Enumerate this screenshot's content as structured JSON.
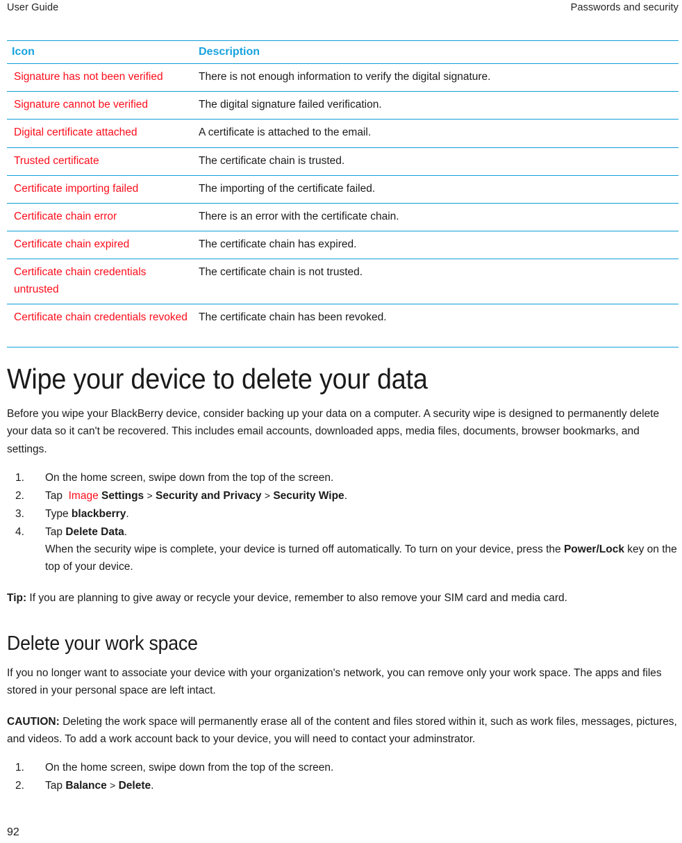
{
  "header": {
    "left": "User Guide",
    "right": "Passwords and security"
  },
  "icon_table": {
    "columns": [
      "Icon",
      "Description"
    ],
    "rows": [
      {
        "icon": "Signature has not been verified",
        "description": "There is not enough information to verify the digital signature."
      },
      {
        "icon": "Signature cannot be verified",
        "description": "The digital signature failed verification."
      },
      {
        "icon": "Digital certificate attached",
        "description": "A certificate is attached to the email."
      },
      {
        "icon": "Trusted certificate",
        "description": "The certificate chain is trusted."
      },
      {
        "icon": "Certificate importing failed",
        "description": "The importing of the certificate failed."
      },
      {
        "icon": "Certificate chain error",
        "description": "There is an error with the certificate chain."
      },
      {
        "icon": "Certificate chain expired",
        "description": "The certificate chain has expired."
      },
      {
        "icon": "Certificate chain credentials untrusted",
        "description": "The certificate chain is not trusted."
      },
      {
        "icon": "Certificate chain credentials revoked",
        "description": "The certificate chain has been revoked."
      }
    ]
  },
  "wipe_section": {
    "title": "Wipe your device to delete your data",
    "intro": "Before you wipe your BlackBerry device, consider backing up your data on a computer. A security wipe is designed to permanently delete your data so it can't be recovered. This includes email accounts, downloaded apps, media files, documents, browser bookmarks, and settings.",
    "steps": {
      "step1": "On the home screen, swipe down from the top of the screen.",
      "step2": {
        "tap": "Tap",
        "image_placeholder": "Image",
        "settings": "Settings",
        "sep1": ">",
        "security_privacy": "Security and Privacy",
        "sep2": ">",
        "security_wipe": "Security Wipe",
        "period": "."
      },
      "step3": {
        "type": "Type",
        "value": "blackberry",
        "period": "."
      },
      "step4": {
        "tap": "Tap",
        "value": "Delete Data",
        "period": ".",
        "note_before": "When the security wipe is complete, your device is turned off automatically. To turn on your device, press the ",
        "note_bold": "Power/Lock",
        "note_after": " key on the top of your device."
      }
    },
    "tip": {
      "label": "Tip:",
      "text": " If you are planning to give away or recycle your device, remember to also remove your SIM card and media card."
    }
  },
  "workspace_section": {
    "title": "Delete your work space",
    "intro": "If you no longer want to associate your device with your organization's network, you can remove only your work space. The apps and files stored in your personal space are left intact.",
    "caution": {
      "label": "CAUTION:",
      "text": " Deleting the work space will permanently erase all of the content and files stored within it, such as work files, messages, pictures, and videos. To add a work account back to your device, you will need to contact your adminstrator."
    },
    "steps": {
      "step1": "On the home screen, swipe down from the top of the screen.",
      "step2": {
        "tap": "Tap",
        "balance": "Balance",
        "sep": ">",
        "delete": "Delete",
        "period": "."
      }
    }
  },
  "footer": {
    "page_number": "92"
  },
  "colors": {
    "rule": "#0e9ed9",
    "table_header_text": "#17a3dd",
    "icon_label_text": "#fc0d1b",
    "body_text": "#1b1b1b"
  }
}
